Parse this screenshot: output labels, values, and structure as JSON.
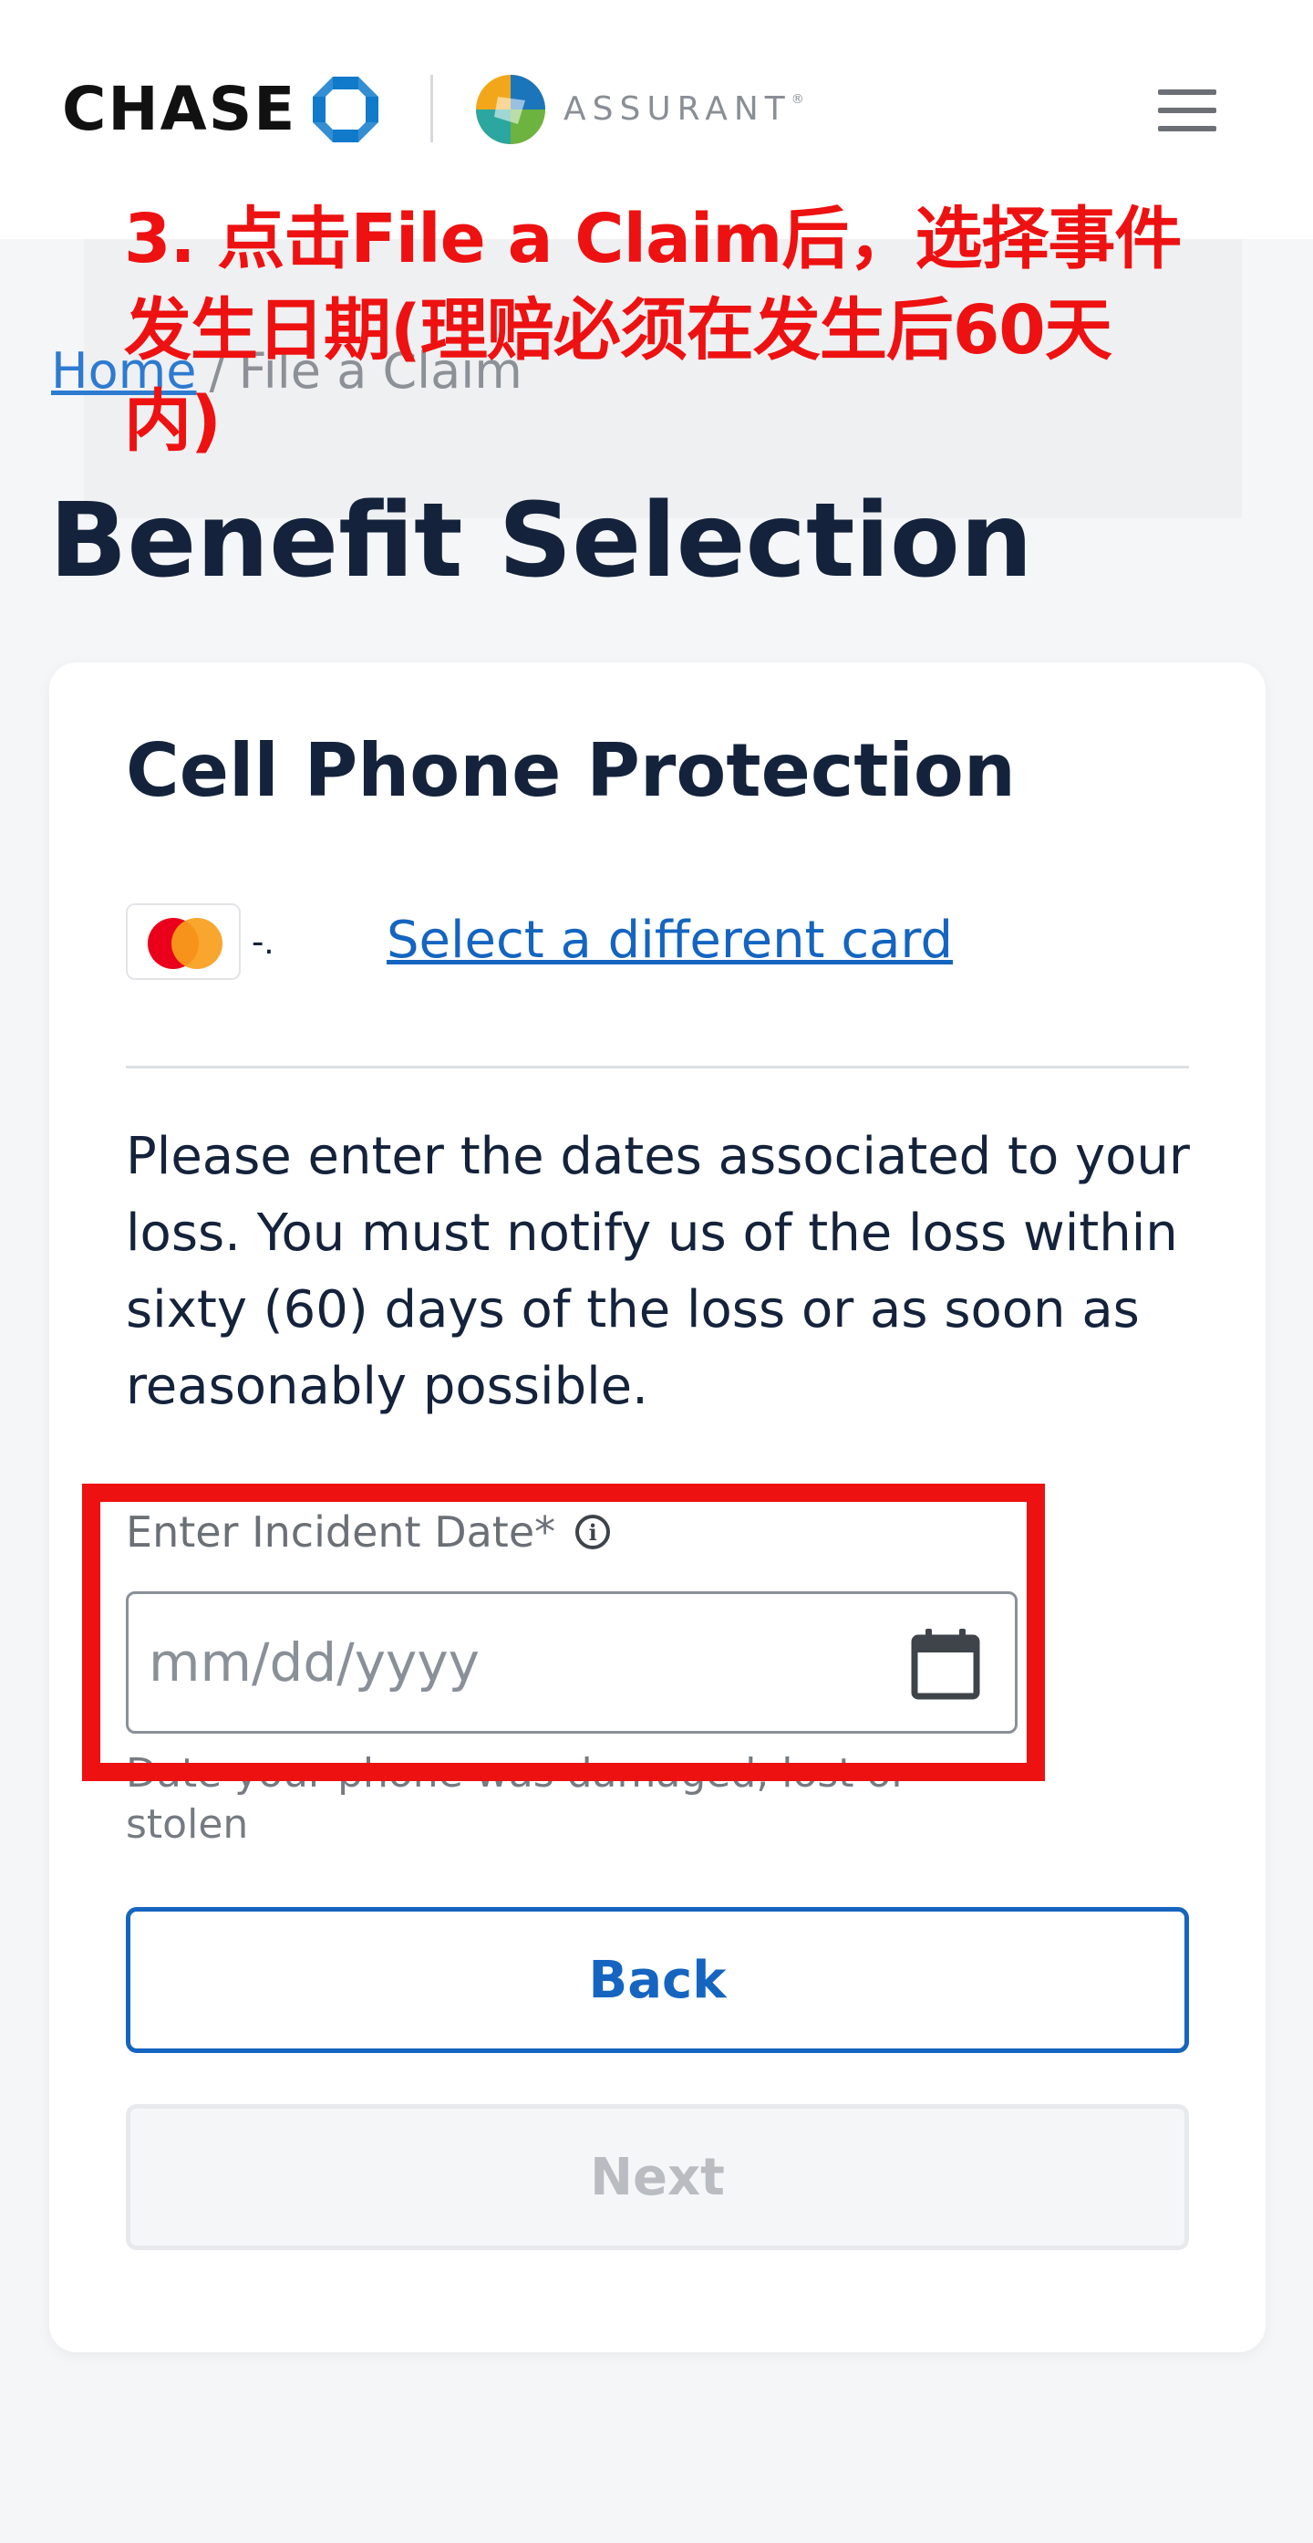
{
  "header": {
    "brand": "CHASE",
    "partner": "ASSURANT",
    "partner_mark": "®"
  },
  "annotation": {
    "text": "3. 点击File a Claim后，选择事件发生日期(理赔必须在发生后60天内)"
  },
  "breadcrumb": {
    "home": "Home",
    "separator": "/",
    "current": "File a Claim"
  },
  "page": {
    "title": "Benefit Selection"
  },
  "card": {
    "title": "Cell Phone Protection",
    "masked_number": "-.",
    "select_card_link": "Select a different card",
    "instructions": "Please enter the dates associated to your loss. You must notify us of the loss within sixty (60) days of the loss or as soon as reasonably possible.",
    "date_label": "Enter Incident Date*",
    "info_glyph": "i",
    "date_value": "",
    "date_placeholder": "mm/dd/yyyy",
    "help_text": "Date your phone was damaged, lost or stolen",
    "back_label": "Back",
    "next_label": "Next"
  },
  "colors": {
    "accent": "#1565c0",
    "annotation_red": "#ee1111",
    "title": "#14233b"
  },
  "icons": {
    "menu": "hamburger-menu-icon",
    "info": "info-icon",
    "calendar": "calendar-icon",
    "mastercard": "mastercard-icon"
  }
}
